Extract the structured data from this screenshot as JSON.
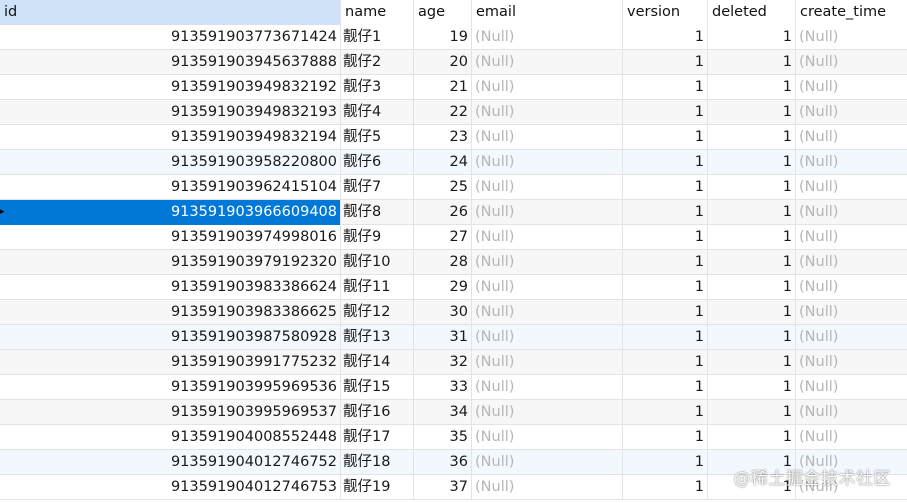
{
  "columns": {
    "id": "id",
    "name": "name",
    "age": "age",
    "email": "email",
    "version": "version",
    "deleted": "deleted",
    "create_time": "create_time"
  },
  "null_text": "(Null)",
  "current_row_marker": "▸",
  "selection_color": "#0078d7",
  "header_selected_color": "#cfe2f8",
  "rows": [
    {
      "id": "913591903773671424",
      "name": "靓仔1",
      "age": "19",
      "version": "1",
      "deleted": "1"
    },
    {
      "id": "913591903945637888",
      "name": "靓仔2",
      "age": "20",
      "version": "1",
      "deleted": "1"
    },
    {
      "id": "913591903949832192",
      "name": "靓仔3",
      "age": "21",
      "version": "1",
      "deleted": "1"
    },
    {
      "id": "913591903949832193",
      "name": "靓仔4",
      "age": "22",
      "version": "1",
      "deleted": "1"
    },
    {
      "id": "913591903949832194",
      "name": "靓仔5",
      "age": "23",
      "version": "1",
      "deleted": "1"
    },
    {
      "id": "913591903958220800",
      "name": "靓仔6",
      "age": "24",
      "version": "1",
      "deleted": "1"
    },
    {
      "id": "913591903962415104",
      "name": "靓仔7",
      "age": "25",
      "version": "1",
      "deleted": "1"
    },
    {
      "id": "913591903966609408",
      "name": "靓仔8",
      "age": "26",
      "version": "1",
      "deleted": "1"
    },
    {
      "id": "913591903974998016",
      "name": "靓仔9",
      "age": "27",
      "version": "1",
      "deleted": "1"
    },
    {
      "id": "913591903979192320",
      "name": "靓仔10",
      "age": "28",
      "version": "1",
      "deleted": "1"
    },
    {
      "id": "913591903983386624",
      "name": "靓仔11",
      "age": "29",
      "version": "1",
      "deleted": "1"
    },
    {
      "id": "913591903983386625",
      "name": "靓仔12",
      "age": "30",
      "version": "1",
      "deleted": "1"
    },
    {
      "id": "913591903987580928",
      "name": "靓仔13",
      "age": "31",
      "version": "1",
      "deleted": "1"
    },
    {
      "id": "913591903991775232",
      "name": "靓仔14",
      "age": "32",
      "version": "1",
      "deleted": "1"
    },
    {
      "id": "913591903995969536",
      "name": "靓仔15",
      "age": "33",
      "version": "1",
      "deleted": "1"
    },
    {
      "id": "913591903995969537",
      "name": "靓仔16",
      "age": "34",
      "version": "1",
      "deleted": "1"
    },
    {
      "id": "913591904008552448",
      "name": "靓仔17",
      "age": "35",
      "version": "1",
      "deleted": "1"
    },
    {
      "id": "913591904012746752",
      "name": "靓仔18",
      "age": "36",
      "version": "1",
      "deleted": "1"
    },
    {
      "id": "913591904012746753",
      "name": "靓仔19",
      "age": "37",
      "version": "1",
      "deleted": "1"
    }
  ],
  "watermark": "@稀土掘金技术社区"
}
